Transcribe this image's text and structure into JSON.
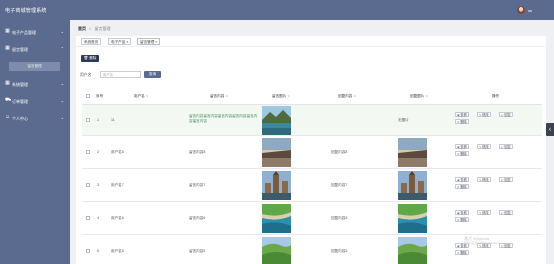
{
  "app": {
    "title": "电子商城管理系统",
    "username": "ss"
  },
  "sidebar": {
    "items": [
      {
        "icon": "grid-icon",
        "label": "电子产品管理",
        "caret": "⌄"
      },
      {
        "icon": "grid-icon",
        "label": "留言管理",
        "caret": "⌃"
      },
      {
        "icon": "grid-icon",
        "label": "系统管理",
        "caret": "⌄"
      },
      {
        "icon": "cart-icon",
        "label": "订单管理",
        "caret": "⌄"
      },
      {
        "icon": "user-icon",
        "label": "个人中心",
        "caret": "⌄"
      }
    ],
    "submenu": {
      "label": "留言管理"
    }
  },
  "breadcrumb": {
    "home": "首页",
    "sep": "//",
    "current": "留言管理"
  },
  "tabs": [
    {
      "label": "系统首页"
    },
    {
      "label": "电子产品 ×"
    },
    {
      "label": "留言管理 ×"
    }
  ],
  "toolbar": {
    "delete_label": "删除",
    "delete_icon": "trash-icon"
  },
  "search": {
    "label": "用户名",
    "placeholder": "用户名",
    "button": "查询"
  },
  "table": {
    "headers": [
      "序号",
      "用户名",
      "留言内容",
      "留言图片",
      "回复内容",
      "回复图片",
      "操作"
    ],
    "actions": {
      "view": "查看",
      "edit": "修改",
      "reply": "回复",
      "delete": "删除"
    },
    "rows": [
      {
        "index": "1",
        "user": "11",
        "content": "留言内容留言内容留言内容留言内容留言内容留言内容",
        "reply": "",
        "reply_image_text": "无图片",
        "image_theme": "lake"
      },
      {
        "index": "2",
        "user": "用户名8",
        "content": "留言内容8",
        "reply": "回复内容8",
        "reply_image_text": "",
        "image_theme": "sunset"
      },
      {
        "index": "3",
        "user": "用户名7",
        "content": "留言内容7",
        "reply": "回复内容7",
        "reply_image_text": "",
        "image_theme": "castle"
      },
      {
        "index": "4",
        "user": "用户名6",
        "content": "留言内容6",
        "reply": "回复内容6",
        "reply_image_text": "",
        "image_theme": "coast"
      },
      {
        "index": "5",
        "user": "用户名5",
        "content": "留言内容5",
        "reply": "回复内容5",
        "reply_image_text": "",
        "image_theme": "hills"
      }
    ]
  },
  "watermark": {
    "line1": "激活 Windows",
    "line2": "转到\"设置\"以激活 Windows。"
  }
}
